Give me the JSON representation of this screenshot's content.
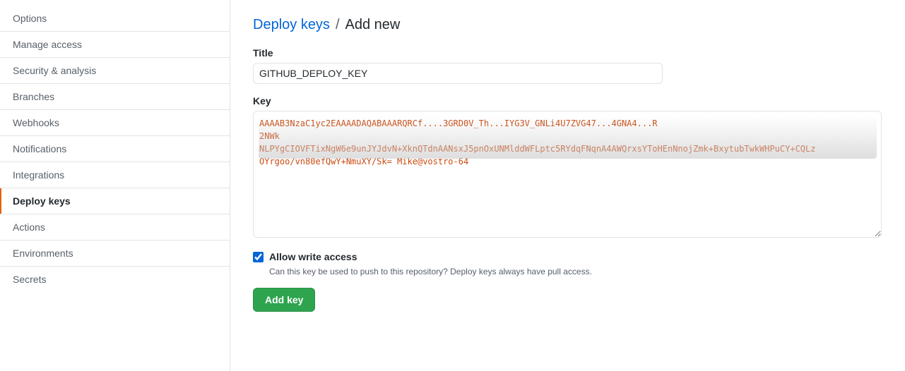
{
  "sidebar": {
    "items": [
      {
        "label": "Options",
        "active": false,
        "id": "options"
      },
      {
        "label": "Manage access",
        "active": false,
        "id": "manage-access"
      },
      {
        "label": "Security & analysis",
        "active": false,
        "id": "security-analysis"
      },
      {
        "label": "Branches",
        "active": false,
        "id": "branches"
      },
      {
        "label": "Webhooks",
        "active": false,
        "id": "webhooks"
      },
      {
        "label": "Notifications",
        "active": false,
        "id": "notifications"
      },
      {
        "label": "Integrations",
        "active": false,
        "id": "integrations"
      },
      {
        "label": "Deploy keys",
        "active": true,
        "id": "deploy-keys"
      },
      {
        "label": "Actions",
        "active": false,
        "id": "actions"
      },
      {
        "label": "Environments",
        "active": false,
        "id": "environments"
      },
      {
        "label": "Secrets",
        "active": false,
        "id": "secrets"
      }
    ]
  },
  "breadcrumb": {
    "link_text": "Deploy keys",
    "separator": "/",
    "current": "Add new"
  },
  "form": {
    "title_label": "Title",
    "title_value": "GITHUB_DEPLOY_KEY",
    "key_label": "Key",
    "key_blurred_text": "AAAAB3NzaC1yc2EAAAADAQABAAARQRCf....3GRD0V_Th...IYG3V_GNLi4U7ZVG47...4GNA4...R",
    "key_number": "2NWk",
    "key_line1": "NLPYgCIOVFTixNgW6e9unJYJdvN+XknQTdnAANsxJ5pnOxUNMlddWFLptc5RYdqFNqnA4AWQrxsYToHEnNnojZmk+BxytubTwkWHPuCY+CQLz",
    "key_line2": "OYrgoo/vn80efQwY+NmuXY/Sk= Mike@vostro-64",
    "allow_write_label": "Allow write access",
    "allow_write_hint": "Can this key be used to push to this repository? Deploy keys always have pull access.",
    "allow_write_checked": true,
    "add_key_button": "Add key"
  }
}
